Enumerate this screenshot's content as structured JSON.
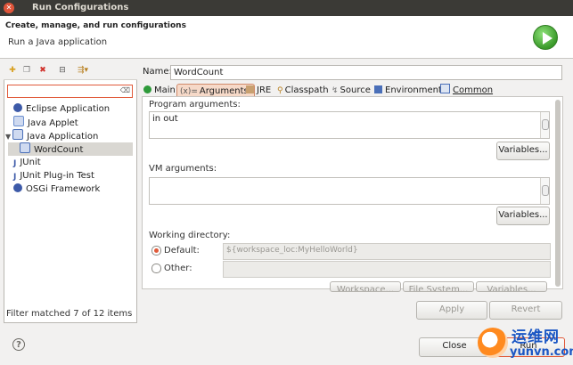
{
  "window": {
    "title": "Run Configurations"
  },
  "header": {
    "title": "Create, manage, and run configurations",
    "subtitle": "Run a Java application"
  },
  "left": {
    "filter_value": "",
    "tree": [
      {
        "label": "Eclipse Application",
        "icon": "eclipse-icon",
        "color": "#3d5aa8"
      },
      {
        "label": "Java Applet",
        "icon": "applet-icon",
        "color": "#6b8fcf"
      },
      {
        "label": "Java Application",
        "icon": "java-app-icon",
        "color": "#4a6fb8",
        "expanded": true
      },
      {
        "label": "WordCount",
        "icon": "java-config-icon",
        "color": "#4a6fb8",
        "selected": true
      },
      {
        "label": "JUnit",
        "icon": "junit-icon",
        "color": "#3d5aa8"
      },
      {
        "label": "JUnit Plug-in Test",
        "icon": "junit-plugin-icon",
        "color": "#3d5aa8"
      },
      {
        "label": "OSGi Framework",
        "icon": "osgi-icon",
        "color": "#3d5aa8"
      }
    ],
    "status": "Filter matched 7 of 12 items"
  },
  "config": {
    "name_label": "Name:",
    "name_value": "WordCount",
    "tabs": [
      "Main",
      "Arguments",
      "JRE",
      "Classpath",
      "Source",
      "Environment",
      "Common"
    ],
    "active_tab": "Arguments",
    "program_args_label": "Program arguments:",
    "program_args_value": "in out",
    "variables_label": "Variables...",
    "vm_args_label": "VM arguments:",
    "vm_args_value": "",
    "working_dir_label": "Working directory:",
    "default_label": "Default:",
    "default_value": "${workspace_loc:MyHelloWorld}",
    "other_label": "Other:",
    "other_value": "",
    "workspace_btn": "Workspace...",
    "filesystem_btn": "File System...",
    "variables_btn2": "Variables..."
  },
  "buttons": {
    "apply": "Apply",
    "revert": "Revert",
    "close": "Close",
    "run": "Run"
  },
  "watermark": {
    "cn": "运维网",
    "url": "yunvn.com"
  },
  "colors": {
    "accent": "#e05a3a",
    "run_green": "#3a9a2a"
  }
}
